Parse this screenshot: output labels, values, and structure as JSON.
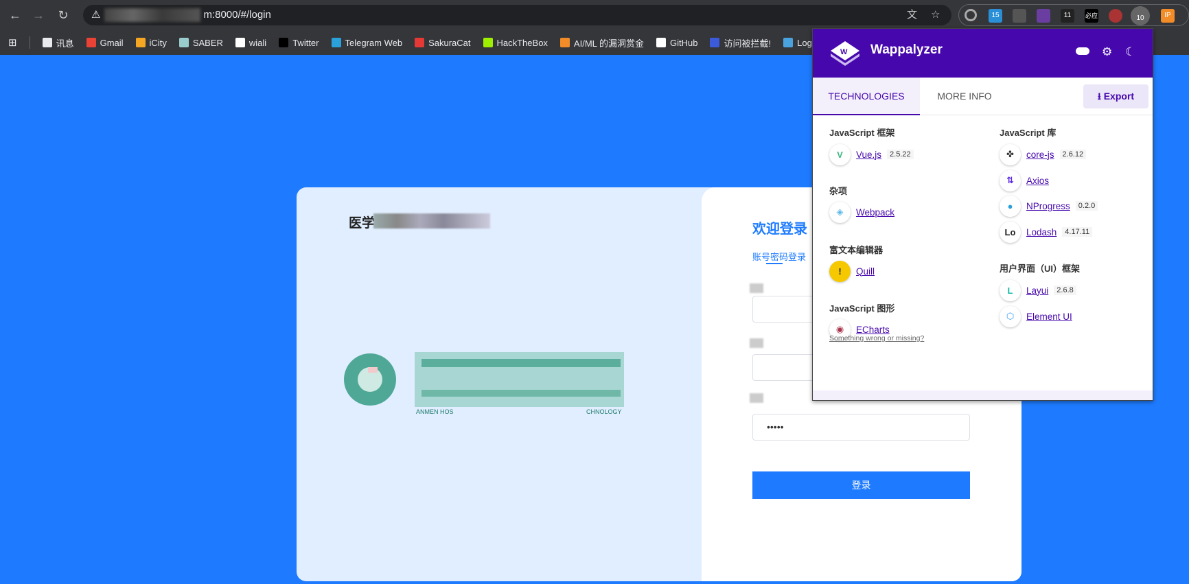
{
  "browser": {
    "url_visible": "m:8000/#/login",
    "bookmarks": [
      {
        "label": "讯息",
        "icon": "folder-icon",
        "color": "#e8eaed"
      },
      {
        "label": "Gmail",
        "icon": "gmail-icon",
        "color": "#ea4335"
      },
      {
        "label": "iCity",
        "icon": "icity-icon",
        "color": "#f5a623"
      },
      {
        "label": "SABER",
        "icon": "saber-icon",
        "color": "#9cc"
      },
      {
        "label": "wiali",
        "icon": "wiali-icon",
        "color": "#fff"
      },
      {
        "label": "Twitter",
        "icon": "x-icon",
        "color": "#000"
      },
      {
        "label": "Telegram Web",
        "icon": "telegram-icon",
        "color": "#2aa1da"
      },
      {
        "label": "SakuraCat",
        "icon": "sakuracat-icon",
        "color": "#e53935"
      },
      {
        "label": "HackTheBox",
        "icon": "hackthebox-icon",
        "color": "#9fef00"
      },
      {
        "label": "AI/ML 的漏洞赏金",
        "icon": "huntr-icon",
        "color": "#f28c28"
      },
      {
        "label": "GitHub",
        "icon": "github-icon",
        "color": "#fff"
      },
      {
        "label": "访问被拦截!",
        "icon": "dots-icon",
        "color": "#3b5bdb"
      },
      {
        "label": "Logi",
        "icon": "n-icon",
        "color": "#4aa3df"
      }
    ],
    "extension_badges": [
      "15",
      "11",
      "必应",
      "10"
    ]
  },
  "login": {
    "site_title": "医学",
    "welcome": "欢迎登录",
    "tab_account": "账号密码登录",
    "password_value": "•••••",
    "login_button": "登录",
    "logo_text_left": "ANMEN HOS",
    "logo_text_right": "CHNOLOGY"
  },
  "wappalyzer": {
    "brand": "Wappalyzer",
    "tabs": [
      "TECHNOLOGIES",
      "MORE INFO"
    ],
    "export": "Export",
    "accent": "#4608ad",
    "left": [
      {
        "category": "JavaScript 框架",
        "items": [
          {
            "name": "Vue.js",
            "version": "2.5.22",
            "icon": "vue-icon"
          }
        ]
      },
      {
        "category": "杂项",
        "items": [
          {
            "name": "Webpack",
            "version": "",
            "icon": "webpack-icon"
          }
        ]
      },
      {
        "category": "富文本编辑器",
        "items": [
          {
            "name": "Quill",
            "version": "",
            "icon": "quill-icon"
          }
        ]
      },
      {
        "category": "JavaScript 图形",
        "items": [
          {
            "name": "ECharts",
            "version": "",
            "icon": "echarts-icon"
          }
        ]
      }
    ],
    "right": [
      {
        "category": "JavaScript 库",
        "items": [
          {
            "name": "core-js",
            "version": "2.6.12",
            "icon": "core-js-icon"
          },
          {
            "name": "Axios",
            "version": "",
            "icon": "axios-icon"
          },
          {
            "name": "NProgress",
            "version": "0.2.0",
            "icon": "nprogress-icon"
          },
          {
            "name": "Lodash",
            "version": "4.17.11",
            "icon": "lodash-icon"
          }
        ]
      },
      {
        "category": "用户界面（UI）框架",
        "items": [
          {
            "name": "Layui",
            "version": "2.6.8",
            "icon": "layui-icon"
          },
          {
            "name": "Element UI",
            "version": "",
            "icon": "element-ui-icon"
          }
        ]
      }
    ],
    "feedback": "Something wrong or missing?"
  }
}
